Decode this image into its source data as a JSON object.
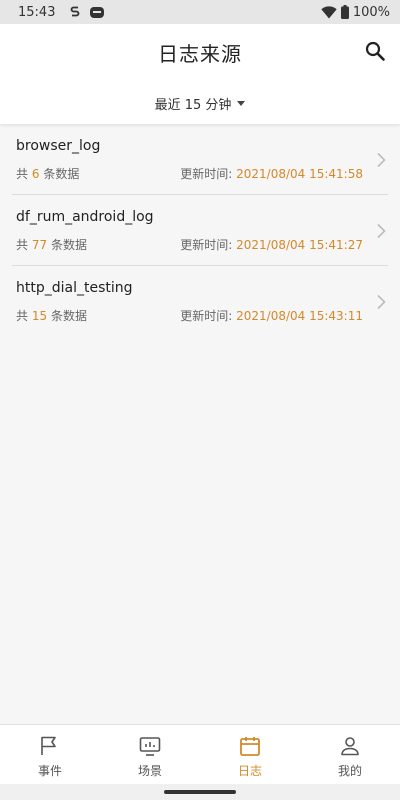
{
  "status_bar": {
    "time": "15:43",
    "battery": "100%",
    "icons": [
      "s-notification-icon",
      "robot-notification-icon",
      "wifi-icon",
      "battery-icon"
    ]
  },
  "header": {
    "title": "日志来源",
    "time_filter": "最近 15 分钟",
    "search_icon": "search-icon"
  },
  "logs": [
    {
      "name": "browser_log",
      "count_prefix": "共",
      "count": "6",
      "count_suffix": "条数据",
      "update_label": "更新时间:",
      "update_time": "2021/08/04 15:41:58"
    },
    {
      "name": "df_rum_android_log",
      "count_prefix": "共",
      "count": "77",
      "count_suffix": "条数据",
      "update_label": "更新时间:",
      "update_time": "2021/08/04 15:41:27"
    },
    {
      "name": "http_dial_testing",
      "count_prefix": "共",
      "count": "15",
      "count_suffix": "条数据",
      "update_label": "更新时间:",
      "update_time": "2021/08/04 15:43:11"
    }
  ],
  "bottom_nav": [
    {
      "label": "事件",
      "icon": "flag-icon",
      "active": false
    },
    {
      "label": "场景",
      "icon": "monitor-icon",
      "active": false
    },
    {
      "label": "日志",
      "icon": "calendar-icon",
      "active": true
    },
    {
      "label": "我的",
      "icon": "person-icon",
      "active": false
    }
  ],
  "colors": {
    "accent": "#d4892a",
    "background": "#f6f6f6",
    "header": "#ffffff"
  }
}
